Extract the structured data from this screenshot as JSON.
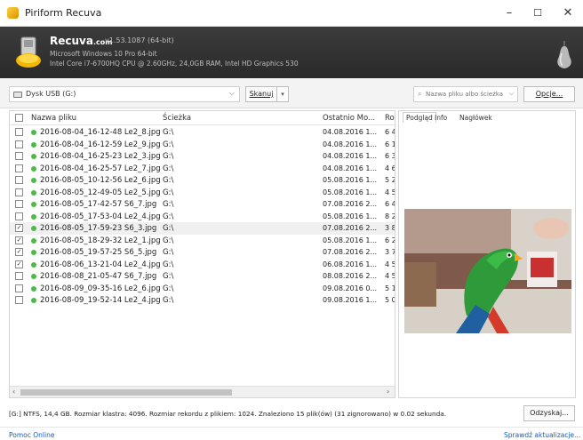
{
  "window": {
    "title": "Piriform Recuva"
  },
  "header": {
    "brand": "Recuva",
    "brand_suffix": ".com",
    "version": "v1.53.1087 (64-bit)",
    "os_line": "Microsoft Windows 10 Pro 64-bit",
    "hw_line": "Intel Core i7-6700HQ CPU @ 2.60GHz, 24,0GB RAM, Intel HD Graphics 530"
  },
  "toolbar": {
    "drive": "Dysk USB (G:)",
    "scan_label": "Skanuj",
    "search_placeholder": "Nazwa pliku albo ścieżka",
    "options_label": "Opcje..."
  },
  "list": {
    "columns": {
      "name": "Nazwa pliku",
      "path": "Ścieżka",
      "date": "Ostatnio Mo...",
      "size": "Ro"
    },
    "rows": [
      {
        "name": "2016-08-04_16-12-48 Le2_8.jpg",
        "path": "G:\\",
        "date": "04.08.2016 1...",
        "size": "6 4",
        "checked": false,
        "selected": false
      },
      {
        "name": "2016-08-04_16-12-59 Le2_9.jpg",
        "path": "G:\\",
        "date": "04.08.2016 1...",
        "size": "6 1",
        "checked": false,
        "selected": false
      },
      {
        "name": "2016-08-04_16-25-23 Le2_3.jpg",
        "path": "G:\\",
        "date": "04.08.2016 1...",
        "size": "6 3",
        "checked": false,
        "selected": false
      },
      {
        "name": "2016-08-04_16-25-57 Le2_7.jpg",
        "path": "G:\\",
        "date": "04.08.2016 1...",
        "size": "4 6",
        "checked": false,
        "selected": false
      },
      {
        "name": "2016-08-05_10-12-56 Le2_6.jpg",
        "path": "G:\\",
        "date": "05.08.2016 1...",
        "size": "5 2",
        "checked": false,
        "selected": false
      },
      {
        "name": "2016-08-05_12-49-05 Le2_5.jpg",
        "path": "G:\\",
        "date": "05.08.2016 1...",
        "size": "4 5",
        "checked": false,
        "selected": false
      },
      {
        "name": "2016-08-05_17-42-57 S6_7.jpg",
        "path": "G:\\",
        "date": "07.08.2016 2...",
        "size": "6 4",
        "checked": false,
        "selected": false
      },
      {
        "name": "2016-08-05_17-53-04 Le2_4.jpg",
        "path": "G:\\",
        "date": "05.08.2016 1...",
        "size": "8 2",
        "checked": false,
        "selected": false
      },
      {
        "name": "2016-08-05_17-59-23 S6_3.jpg",
        "path": "G:\\",
        "date": "07.08.2016 2...",
        "size": "3 8",
        "checked": true,
        "selected": true
      },
      {
        "name": "2016-08-05_18-29-32 Le2_1.jpg",
        "path": "G:\\",
        "date": "05.08.2016 1...",
        "size": "6 2",
        "checked": true,
        "selected": false
      },
      {
        "name": "2016-08-05_19-57-25 S6_5.jpg",
        "path": "G:\\",
        "date": "07.08.2016 2...",
        "size": "3 7",
        "checked": true,
        "selected": false
      },
      {
        "name": "2016-08-06_13-21-04 Le2_4.jpg",
        "path": "G:\\",
        "date": "06.08.2016 1...",
        "size": "4 5",
        "checked": true,
        "selected": false
      },
      {
        "name": "2016-08-08_21-05-47 S6_7.jpg",
        "path": "G:\\",
        "date": "08.08.2016 2...",
        "size": "4 5",
        "checked": false,
        "selected": false
      },
      {
        "name": "2016-08-09_09-35-16 Le2_6.jpg",
        "path": "G:\\",
        "date": "09.08.2016 0...",
        "size": "5 1",
        "checked": false,
        "selected": false
      },
      {
        "name": "2016-08-09_19-52-14 Le2_4.jpg",
        "path": "G:\\",
        "date": "09.08.2016 1...",
        "size": "5 0",
        "checked": false,
        "selected": false
      }
    ]
  },
  "preview": {
    "tabs": [
      "Podgląd",
      "Info",
      "Nagłówek"
    ],
    "active_tab": 0
  },
  "status": {
    "text": "[G:] NTFS, 14,4 GB. Rozmiar klastra: 4096. Rozmiar rekordu z plikiem: 1024. Znaleziono 15 plik(ów) (31 zignorowano) w 0.02 sekunda.",
    "recover_label": "Odzyskaj..."
  },
  "footer": {
    "help_link": "Pomoc Online",
    "update_link": "Sprawdź aktualizacje..."
  },
  "colors": {
    "header_bg": "#2f2f2f",
    "deleted_ok_dot": "#4cba48",
    "link": "#1a5bb8"
  }
}
